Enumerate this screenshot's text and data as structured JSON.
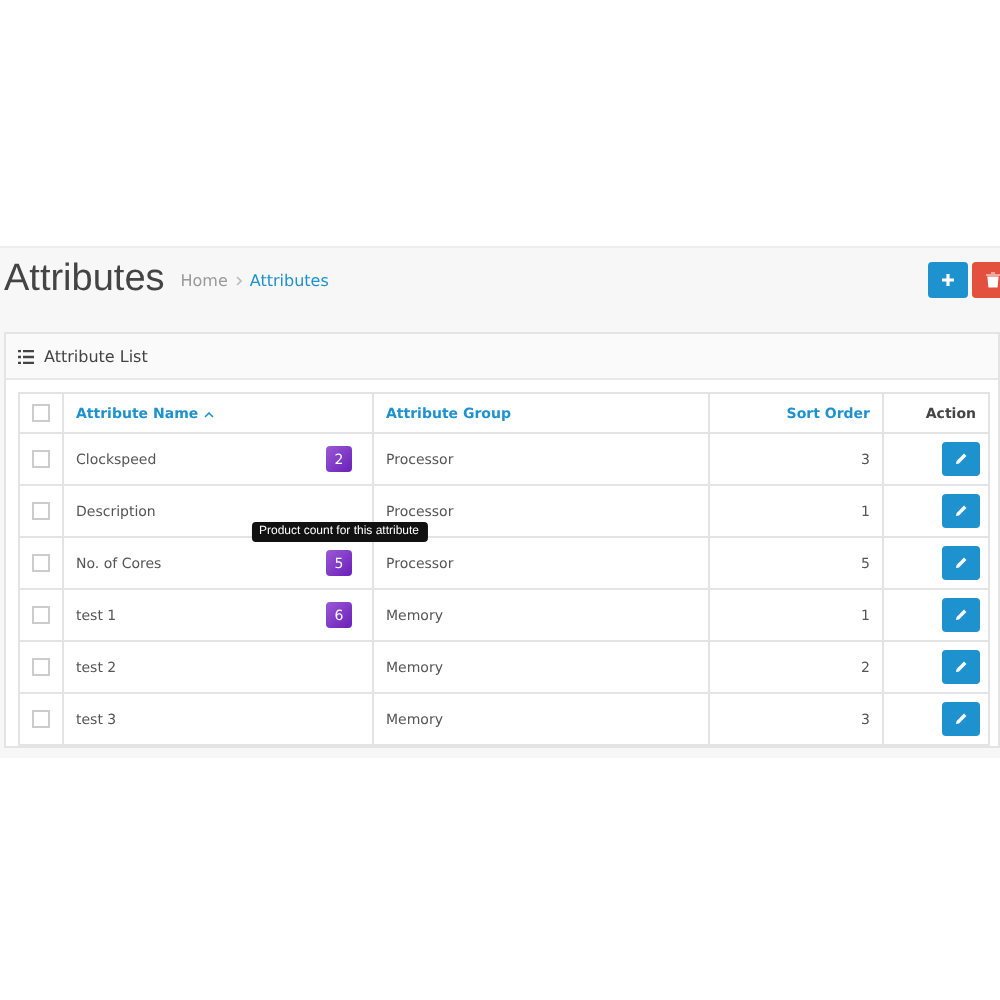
{
  "page_title": "Attributes",
  "breadcrumb": [
    {
      "label": "Home"
    },
    {
      "label": "Attributes"
    }
  ],
  "panel": {
    "title": "Attribute List"
  },
  "table": {
    "select_all_checked": false,
    "columns": [
      {
        "label": "Attribute Name",
        "sorted": true
      },
      {
        "label": "Attribute Group",
        "sorted": false
      },
      {
        "label": "Sort Order",
        "sorted": false
      },
      {
        "label": "Action",
        "sorted": false
      }
    ],
    "rows": [
      {
        "checked": false,
        "name": "Clockspeed",
        "count": "2",
        "group": "Processor",
        "sort_order": "3"
      },
      {
        "checked": false,
        "name": "Description",
        "group": "Processor",
        "sort_order": "1"
      },
      {
        "checked": false,
        "name": "No. of Cores",
        "count": "5",
        "tooltip": "Product count for this attribute",
        "group": "Processor",
        "sort_order": "5"
      },
      {
        "checked": false,
        "name": "test 1",
        "count": "6",
        "group": "Memory",
        "sort_order": "1"
      },
      {
        "checked": false,
        "name": "test 2",
        "group": "Memory",
        "sort_order": "2"
      },
      {
        "checked": false,
        "name": "test 3",
        "group": "Memory",
        "sort_order": "3"
      }
    ]
  }
}
